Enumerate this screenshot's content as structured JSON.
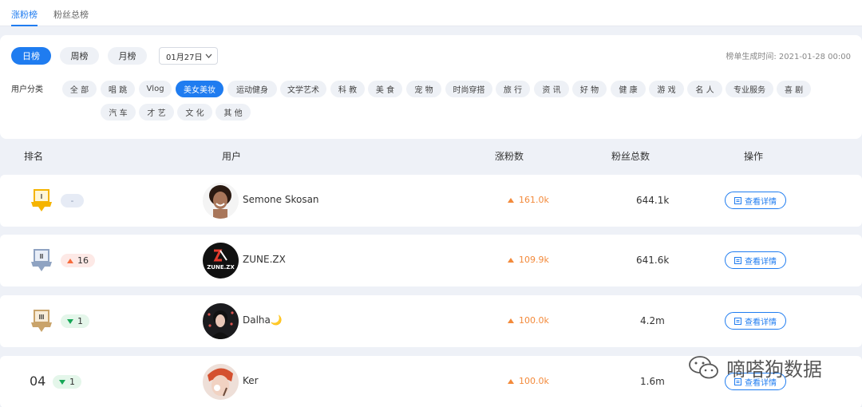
{
  "tabs": {
    "items": [
      "涨粉榜",
      "粉丝总榜"
    ],
    "active": 0
  },
  "filters": {
    "periods": [
      "日榜",
      "周榜",
      "月榜"
    ],
    "active_period": 0,
    "date": "01月27日",
    "generated": "榜单生成时间: 2021-01-28 00:00",
    "category_label": "用户分类",
    "categories": [
      "全 部",
      "唱 跳",
      "Vlog",
      "美女美妆",
      "运动健身",
      "文学艺术",
      "科 教",
      "美 食",
      "宠 物",
      "时尚穿搭",
      "旅 行",
      "资 讯",
      "好 物",
      "健 康",
      "游 戏",
      "名 人",
      "专业服务",
      "喜 剧",
      "汽 车",
      "才 艺",
      "文 化",
      "其 他"
    ],
    "active_category": 3
  },
  "table": {
    "headers": {
      "rank": "排名",
      "user": "用户",
      "gain": "涨粉数",
      "total": "粉丝总数",
      "action": "操作"
    },
    "rows": [
      {
        "rank": "1",
        "medal": "gold-medal-icon",
        "medal_mark": "I",
        "change": "-",
        "change_dir": "none",
        "name": "Semone Skosan",
        "gain": "161.0k",
        "total": "644.1k",
        "action": "查看详情"
      },
      {
        "rank": "2",
        "medal": "silver-medal-icon",
        "medal_mark": "II",
        "change": "16",
        "change_dir": "up",
        "name": "ZUNE.ZX",
        "avatar_text": "ZUNE.ZX",
        "gain": "109.9k",
        "total": "641.6k",
        "action": "查看详情"
      },
      {
        "rank": "3",
        "medal": "bronze-medal-icon",
        "medal_mark": "III",
        "change": "1",
        "change_dir": "down",
        "name": "Dalha🌙",
        "gain": "100.0k",
        "total": "4.2m",
        "action": "查看详情"
      },
      {
        "rank": "04",
        "change": "1",
        "change_dir": "down",
        "name": "Ker",
        "gain": "100.0k",
        "total": "1.6m",
        "action": "查看详情"
      }
    ]
  },
  "watermark": {
    "text": "嘀嗒狗数据"
  },
  "colors": {
    "accent": "#1f7cf0",
    "gain": "#f38a3b",
    "up": "#f76b3c",
    "down": "#17a757",
    "gold": "#f5b400",
    "silver": "#8fa3c2",
    "bronze": "#c9a36a"
  }
}
